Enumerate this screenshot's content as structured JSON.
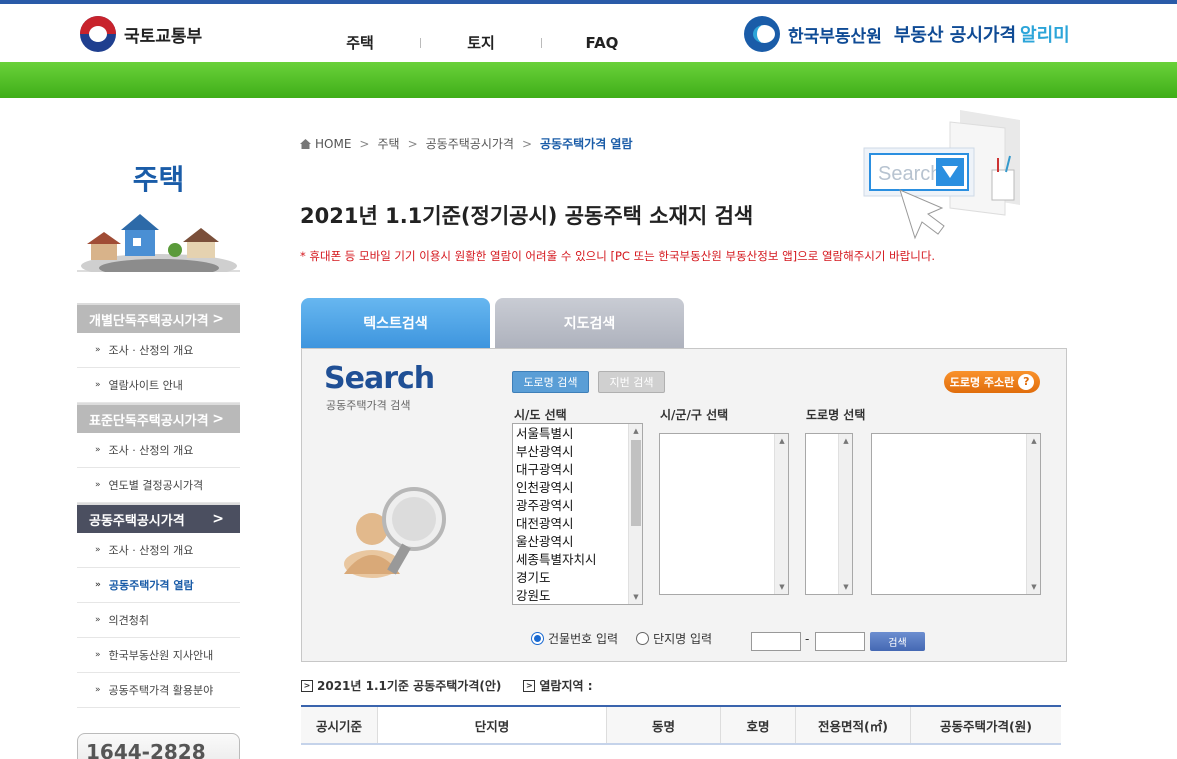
{
  "header": {
    "ministry": "국토교통부",
    "nav": [
      "주택",
      "토지",
      "FAQ"
    ],
    "agency": "한국부동산원",
    "service_main": "부동산 공시가격",
    "service_accent": "알리미"
  },
  "sidebar": {
    "title": "주택",
    "groups": [
      {
        "label": "개별단독주택공시가격",
        "active": false,
        "items": [
          "조사 · 산정의 개요",
          "열람사이트 안내"
        ]
      },
      {
        "label": "표준단독주택공시가격",
        "active": false,
        "items": [
          "조사 · 산정의 개요",
          "연도별 결정공시가격"
        ]
      },
      {
        "label": "공동주택공시가격",
        "active": true,
        "items": [
          "조사 · 산정의 개요",
          "공동주택가격 열람",
          "의견청취",
          "한국부동산원 지사안내",
          "공동주택가격 활용분야"
        ]
      }
    ],
    "phone": "1644-2828"
  },
  "breadcrumb": [
    "HOME",
    "주택",
    "공동주택공시가격",
    "공동주택가격 열람"
  ],
  "page": {
    "title": "2021년 1.1기준(정기공시) 공동주택 소재지 검색",
    "notice": "* 휴대폰 등 모바일 기기 이용시 원활한 열람이 어려울 수 있으니 [PC 또는 한국부동산원 부동산정보 앱]으로 열람해주시기 바랍니다.",
    "illustration_text": "Search"
  },
  "tabs": [
    "텍스트검색",
    "지도검색"
  ],
  "search": {
    "title": "Search",
    "subtitle": "공동주택가격 검색",
    "btn_road": "도로명 검색",
    "btn_jibun": "지번 검색",
    "btn_guide": "도로명 주소란",
    "label_sido": "시/도 선택",
    "label_sigungu": "시/군/구 선택",
    "label_road": "도로명 선택",
    "sido_options": [
      "서울특별시",
      "부산광역시",
      "대구광역시",
      "인천광역시",
      "광주광역시",
      "대전광역시",
      "울산광역시",
      "세종특별자치시",
      "경기도",
      "강원도"
    ],
    "radio_building": "건물번호 입력",
    "radio_complex": "단지명 입력",
    "dash": "-",
    "btn_search": "검색"
  },
  "info": {
    "basis": "2021년 1.1기준 공동주택가격(안)",
    "area_label": "열람지역 :"
  },
  "table": {
    "headers": [
      "공시기준",
      "단지명",
      "동명",
      "호명",
      "전용면적(㎡)",
      "공동주택가격(원)"
    ]
  }
}
